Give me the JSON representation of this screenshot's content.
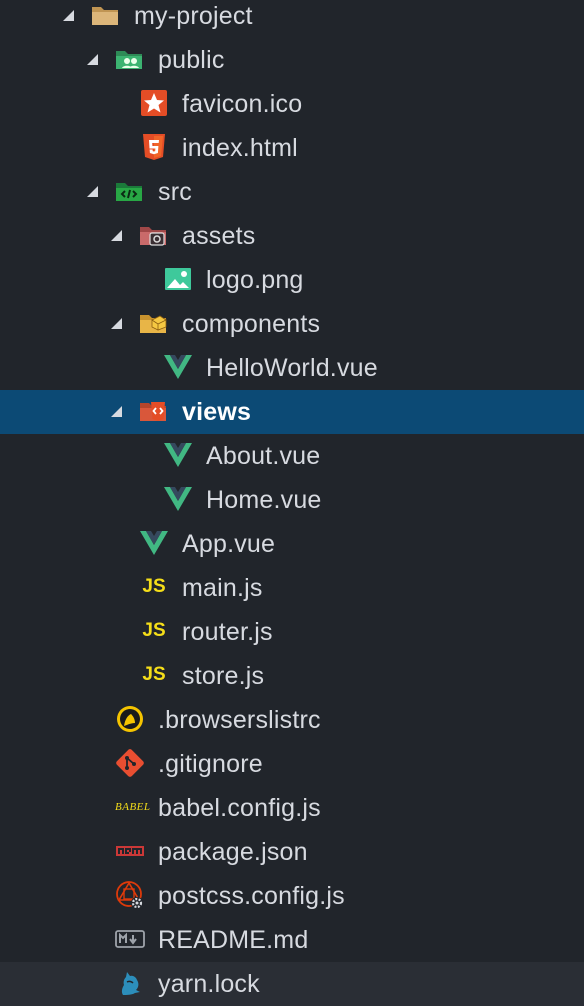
{
  "tree": [
    {
      "label": "my-project",
      "chevron": true,
      "icon": "folder-icon"
    },
    {
      "label": "public",
      "chevron": true,
      "icon": "public-folder-icon"
    },
    {
      "label": "favicon.ico",
      "chevron": false,
      "icon": "star-icon"
    },
    {
      "label": "index.html",
      "chevron": false,
      "icon": "html5-icon"
    },
    {
      "label": "src",
      "chevron": true,
      "icon": "src-folder-icon"
    },
    {
      "label": "assets",
      "chevron": true,
      "icon": "assets-folder-icon"
    },
    {
      "label": "logo.png",
      "chevron": false,
      "icon": "image-icon"
    },
    {
      "label": "components",
      "chevron": true,
      "icon": "components-folder-icon"
    },
    {
      "label": "HelloWorld.vue",
      "chevron": false,
      "icon": "vue-icon"
    },
    {
      "label": "views",
      "chevron": true,
      "icon": "views-folder-icon",
      "selected": true
    },
    {
      "label": "About.vue",
      "chevron": false,
      "icon": "vue-icon"
    },
    {
      "label": "Home.vue",
      "chevron": false,
      "icon": "vue-icon"
    },
    {
      "label": "App.vue",
      "chevron": false,
      "icon": "vue-icon"
    },
    {
      "label": "main.js",
      "chevron": false,
      "icon": "js-icon",
      "badge": "JS"
    },
    {
      "label": "router.js",
      "chevron": false,
      "icon": "js-icon",
      "badge": "JS"
    },
    {
      "label": "store.js",
      "chevron": false,
      "icon": "js-icon",
      "badge": "JS"
    },
    {
      "label": ".browserslistrc",
      "chevron": false,
      "icon": "browserslist-icon"
    },
    {
      "label": ".gitignore",
      "chevron": false,
      "icon": "git-icon"
    },
    {
      "label": "babel.config.js",
      "chevron": false,
      "icon": "babel-icon",
      "badge": "BABEL"
    },
    {
      "label": "package.json",
      "chevron": false,
      "icon": "npm-icon"
    },
    {
      "label": "postcss.config.js",
      "chevron": false,
      "icon": "postcss-icon"
    },
    {
      "label": "README.md",
      "chevron": false,
      "icon": "markdown-icon"
    },
    {
      "label": "yarn.lock",
      "chevron": false,
      "icon": "yarn-icon",
      "hovered": true
    }
  ],
  "colors": {
    "background": "#21252b",
    "selected": "#0c4a75",
    "hovered": "#2a2e35",
    "text": "#d7dae0",
    "vue": "#41b883",
    "js": "#f5de19"
  }
}
